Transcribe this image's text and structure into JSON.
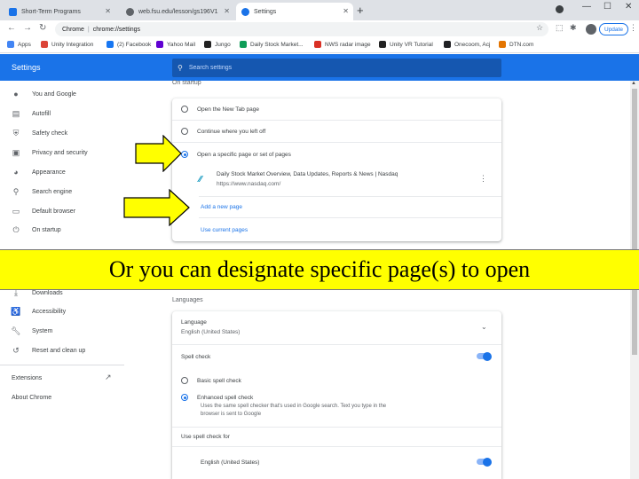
{
  "browser": {
    "tabs": [
      {
        "label": "Short-Term Programs",
        "color": "#1a73e8"
      },
      {
        "label": "web.fsu.edu/lesson/gs196V1",
        "color": "#5f6368"
      },
      {
        "label": "Settings",
        "color": "#1a73e8"
      }
    ],
    "omnibox": {
      "chip": "Chrome",
      "url": "chrome://settings"
    },
    "update_label": "Update",
    "bookmarks": [
      {
        "label": "Apps",
        "color": "#4285f4"
      },
      {
        "label": "Unity Integration",
        "color": "#db4437"
      },
      {
        "label": "(2) Facebook",
        "color": "#1877f2"
      },
      {
        "label": "Yahoo Mail",
        "color": "#6001d2"
      },
      {
        "label": "Jungo",
        "color": "#222222"
      },
      {
        "label": "Daily Stock Market...",
        "color": "#0f9d58"
      },
      {
        "label": "NWS radar image",
        "color": "#d93025"
      },
      {
        "label": "Unity VR Tutorial",
        "color": "#222222"
      },
      {
        "label": "Onecoom, Acj",
        "color": "#202124"
      },
      {
        "label": "DTN.com",
        "color": "#e37400"
      }
    ]
  },
  "settings": {
    "title": "Settings",
    "search_placeholder": "Search settings",
    "sidebar": [
      {
        "label": "You and Google",
        "icon": "person-icon"
      },
      {
        "label": "Autofill",
        "icon": "clipboard-icon"
      },
      {
        "label": "Safety check",
        "icon": "shield-icon"
      },
      {
        "label": "Privacy and security",
        "icon": "lock-icon"
      },
      {
        "label": "Appearance",
        "icon": "palette-icon"
      },
      {
        "label": "Search engine",
        "icon": "search-icon"
      },
      {
        "label": "Default browser",
        "icon": "browser-icon"
      },
      {
        "label": "On startup",
        "icon": "power-icon"
      }
    ],
    "sidebar_lower": [
      {
        "label": "Downloads",
        "icon": "download-icon"
      },
      {
        "label": "Accessibility",
        "icon": "accessibility-icon"
      },
      {
        "label": "System",
        "icon": "wrench-icon"
      },
      {
        "label": "Reset and clean up",
        "icon": "reset-icon"
      }
    ],
    "extensions_label": "Extensions",
    "about_label": "About Chrome",
    "on_startup": {
      "title": "On startup",
      "options": [
        {
          "label": "Open the New Tab page",
          "selected": false
        },
        {
          "label": "Continue where you left off",
          "selected": false
        },
        {
          "label": "Open a specific page or set of pages",
          "selected": true
        }
      ],
      "page": {
        "title": "Daily Stock Market Overview, Data Updates, Reports & News | Nasdaq",
        "url": "https://www.nasdaq.com/"
      },
      "add_page": "Add a new page",
      "use_current": "Use current pages"
    },
    "languages": {
      "title": "Languages",
      "language_label": "Language",
      "language_value": "English (United States)",
      "spell_check": "Spell check",
      "basic_spell": "Basic spell check",
      "enhanced_spell": "Enhanced spell check",
      "enhanced_desc_1": "Uses the same spell checker that's used in Google search. Text you type in the",
      "enhanced_desc_2": "browser is sent to Google",
      "use_spell_for": "Use spell check for",
      "spell_lang": "English (United States)"
    }
  },
  "banner": {
    "text": "Or you can designate specific page(s) to open"
  },
  "colors": {
    "accent": "#1a73e8",
    "arrow_fill": "#ffff00",
    "banner": "#ffff00"
  }
}
